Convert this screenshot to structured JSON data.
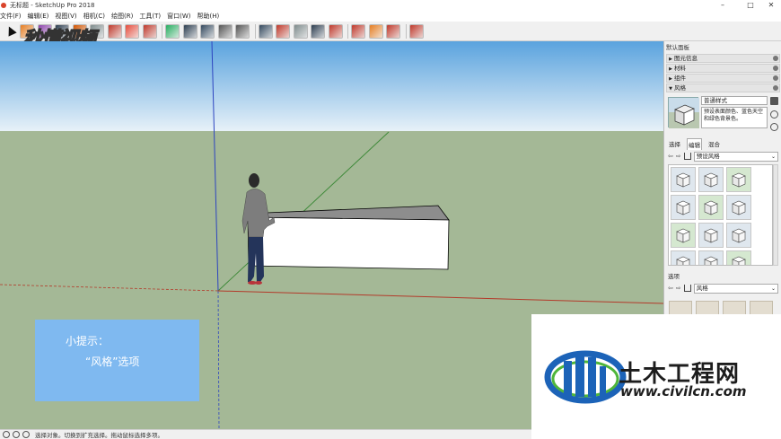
{
  "window": {
    "title": "无标题 - SketchUp Pro 2018",
    "controls": [
      "–",
      "□",
      "✕"
    ]
  },
  "menu": [
    "文件(F)",
    "编辑(E)",
    "视图(V)",
    "相机(C)",
    "绘图(R)",
    "工具(T)",
    "窗口(W)",
    "帮助(H)"
  ],
  "toolbar": {
    "tools": [
      "select-tool",
      "eraser-tool",
      "paint-tool",
      "line-tool",
      "arc-tool",
      "shape-tool",
      "push-pull-tool",
      "move-tool",
      "rotate-tool",
      "scale-tool",
      "offset-tool",
      "tape-measure-tool",
      "text-tool",
      "axes-tool",
      "3d-text-tool",
      "orbit-tool",
      "pan-tool",
      "zoom-tool",
      "zoom-extents-tool",
      "warehouse-tool",
      "extension-warehouse-tool",
      "send-to-layout-tool",
      "ruby-tool"
    ]
  },
  "watermark": "秒懂视频",
  "tip": {
    "line1": "小提示：",
    "line2": "“风格”选项"
  },
  "panel": {
    "tray_title": "默认面板",
    "sections": [
      {
        "label": "图元信息",
        "expanded": false
      },
      {
        "label": "材料",
        "expanded": false
      },
      {
        "label": "组件",
        "expanded": false
      },
      {
        "label": "风格",
        "expanded": true
      }
    ],
    "style_name": "普通样式",
    "style_description": "预设表面颜色、蓝色天空和绿色背景色。",
    "tabs": [
      "选择",
      "编辑",
      "混合"
    ],
    "active_tab": "选择",
    "collection_select": "预设风格",
    "sub_section": "选项",
    "sub_select": "风格"
  },
  "statusbar": {
    "text": "选择对象。切换到扩充选择。拖动鼠标选择多项。"
  },
  "logo": {
    "brand": "土木工程网",
    "url": "www.civilcn.com"
  },
  "colors": {
    "sky_top": "#5aa3de",
    "sky_bottom": "#e7f1f8",
    "ground": "#a4b896",
    "tip_bg": "#7fb9f0",
    "axis_red": "#b33a2a",
    "axis_green": "#3f8a3a",
    "axis_blue": "#2d44c0"
  }
}
